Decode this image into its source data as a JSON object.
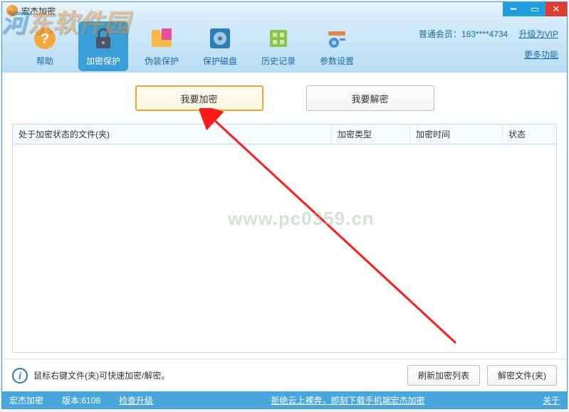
{
  "title": "宏杰加密",
  "watermark": {
    "brand_left": "河",
    "brand_right": "东软件园",
    "url": "www.pc0359.cn"
  },
  "toolbar": {
    "items": [
      {
        "label": "帮助"
      },
      {
        "label": "加密保护"
      },
      {
        "label": "伪装保护"
      },
      {
        "label": "保护磁盘"
      },
      {
        "label": "历史记录"
      },
      {
        "label": "参数设置"
      }
    ],
    "member": "普通会员：183****4734",
    "upgrade": "升级为VIP",
    "more": "更多功能"
  },
  "actions": {
    "encrypt": "我要加密",
    "decrypt": "我要解密"
  },
  "table": {
    "h1": "处于加密状态的文件(夹)",
    "h2": "加密类型",
    "h3": "加密时间",
    "h4": "状态"
  },
  "hint": "鼠标右键文件(夹)可快速加密/解密。",
  "footerButtons": {
    "refresh": "刷新加密列表",
    "decrypt": "解密文件(夹)"
  },
  "status": {
    "app": "宏杰加密",
    "version": "版本:6108",
    "checkUpdate": "检查升级",
    "promo": "拒绝云上裸奔，即刻下载手机端宏杰加密",
    "about": "关于"
  }
}
